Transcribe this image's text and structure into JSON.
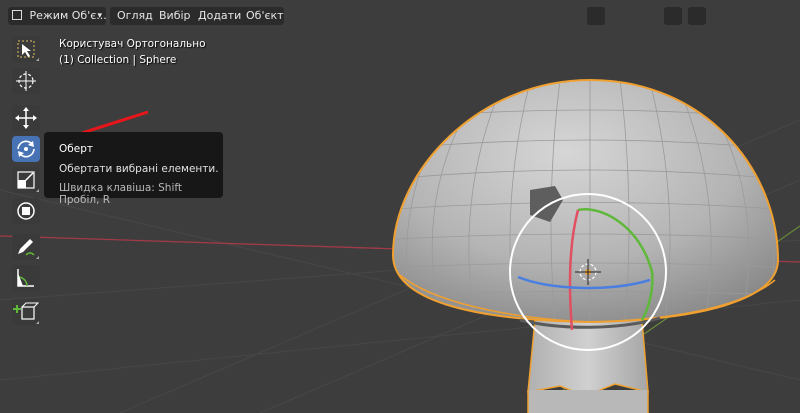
{
  "header": {
    "mode_select": "Режим Об'є...",
    "menu": [
      "Огляд",
      "Вибір",
      "Додати",
      "Об'єкт"
    ]
  },
  "viewport": {
    "view_name": "Користувач Ортогонально",
    "collection": "(1) Collection | Sphere"
  },
  "toolbar": {
    "tools": [
      {
        "name": "select-box",
        "active": false
      },
      {
        "name": "cursor",
        "active": false
      },
      {
        "name": "move",
        "active": false
      },
      {
        "name": "rotate",
        "active": true
      },
      {
        "name": "scale",
        "active": false
      },
      {
        "name": "transform",
        "active": false
      },
      {
        "name": "annotate",
        "active": false
      },
      {
        "name": "measure",
        "active": false
      },
      {
        "name": "add-cube",
        "active": false
      }
    ]
  },
  "tooltip": {
    "title": "Оберт",
    "description": "Обертати вибрані елементи.",
    "hotkey": "Швидка клавіша: Shift Пробіл, R"
  },
  "colors": {
    "accent": "#4772b3",
    "selection_outline": "#f0a030",
    "x_axis": "#e05060",
    "annotation_arrow": "#e8161b"
  }
}
